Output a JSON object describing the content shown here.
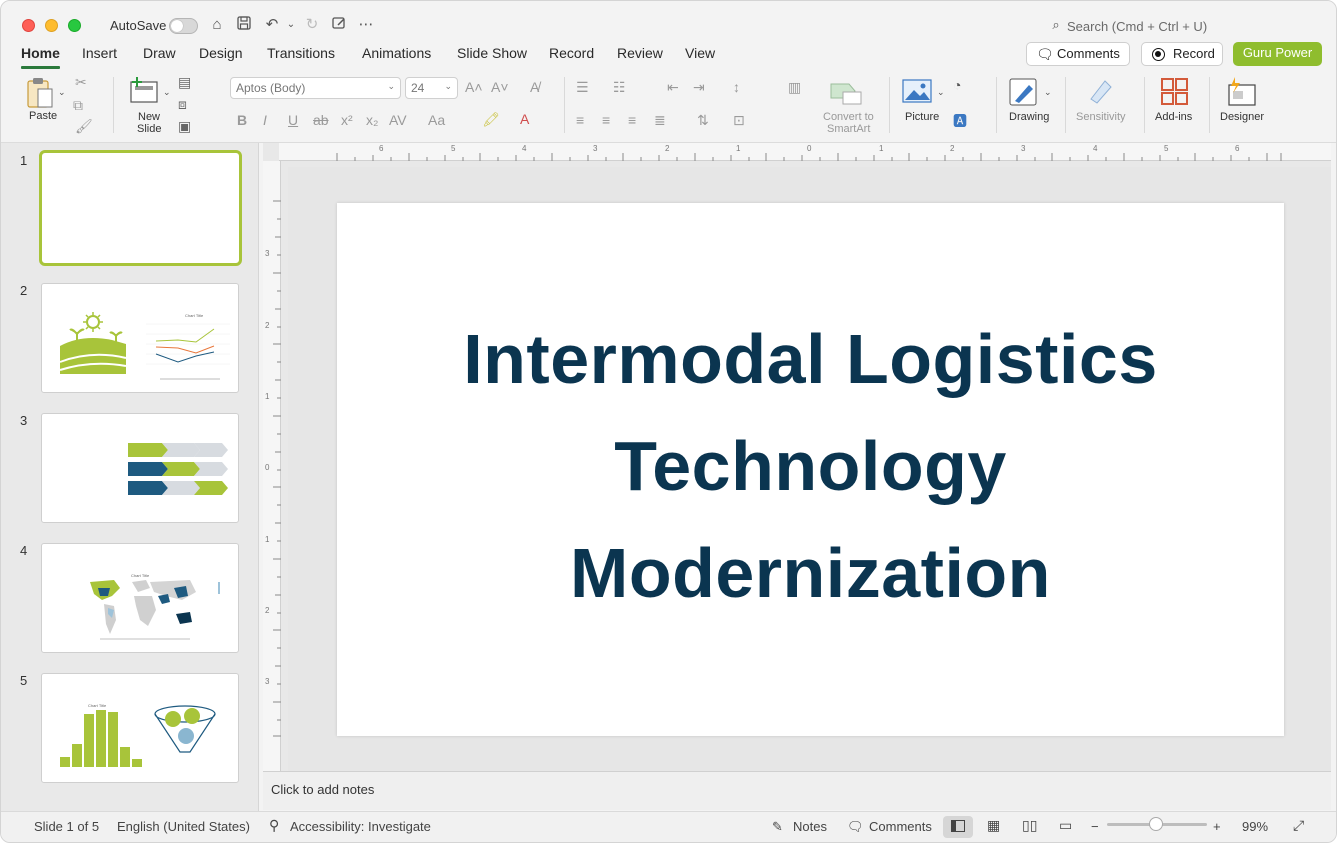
{
  "titlebar": {
    "autosave_label": "AutoSave",
    "search_placeholder": "Search (Cmd + Ctrl + U)"
  },
  "tabs": [
    "Home",
    "Insert",
    "Draw",
    "Design",
    "Transitions",
    "Animations",
    "Slide Show",
    "Record",
    "Review",
    "View"
  ],
  "header_buttons": {
    "comments": "Comments",
    "record": "Record",
    "guru": "Guru Power"
  },
  "ribbon": {
    "paste": "Paste",
    "new_slide_line1": "New",
    "new_slide_line2": "Slide",
    "font_name": "Aptos (Body)",
    "font_size": "24",
    "convert_line1": "Convert to",
    "convert_line2": "SmartArt",
    "picture": "Picture",
    "drawing": "Drawing",
    "sensitivity": "Sensitivity",
    "addins": "Add-ins",
    "designer": "Designer"
  },
  "thumbnails": [
    {
      "num": "1"
    },
    {
      "num": "2",
      "chart_title": "Chart Title"
    },
    {
      "num": "3"
    },
    {
      "num": "4",
      "chart_title": "Chart Title"
    },
    {
      "num": "5",
      "chart_title": "Chart Title"
    }
  ],
  "ruler": {
    "h_labels": [
      "6",
      "5",
      "4",
      "3",
      "2",
      "1",
      "0",
      "1",
      "2",
      "3",
      "4",
      "5",
      "6"
    ],
    "v_labels": [
      "3",
      "2",
      "1",
      "0",
      "1",
      "2",
      "3"
    ]
  },
  "slide": {
    "title_line1": "Intermodal Logistics",
    "title_line2": "Technology",
    "title_line3": "Modernization"
  },
  "notes_placeholder": "Click to add notes",
  "status": {
    "slide_counter": "Slide 1 of 5",
    "language": "English (United States)",
    "accessibility": "Accessibility: Investigate",
    "notes": "Notes",
    "comments": "Comments",
    "zoom": "99%"
  },
  "colors": {
    "title_navy": "#0b3550",
    "accent_green": "#a8c43a",
    "brand_green": "#8fbd2e"
  }
}
